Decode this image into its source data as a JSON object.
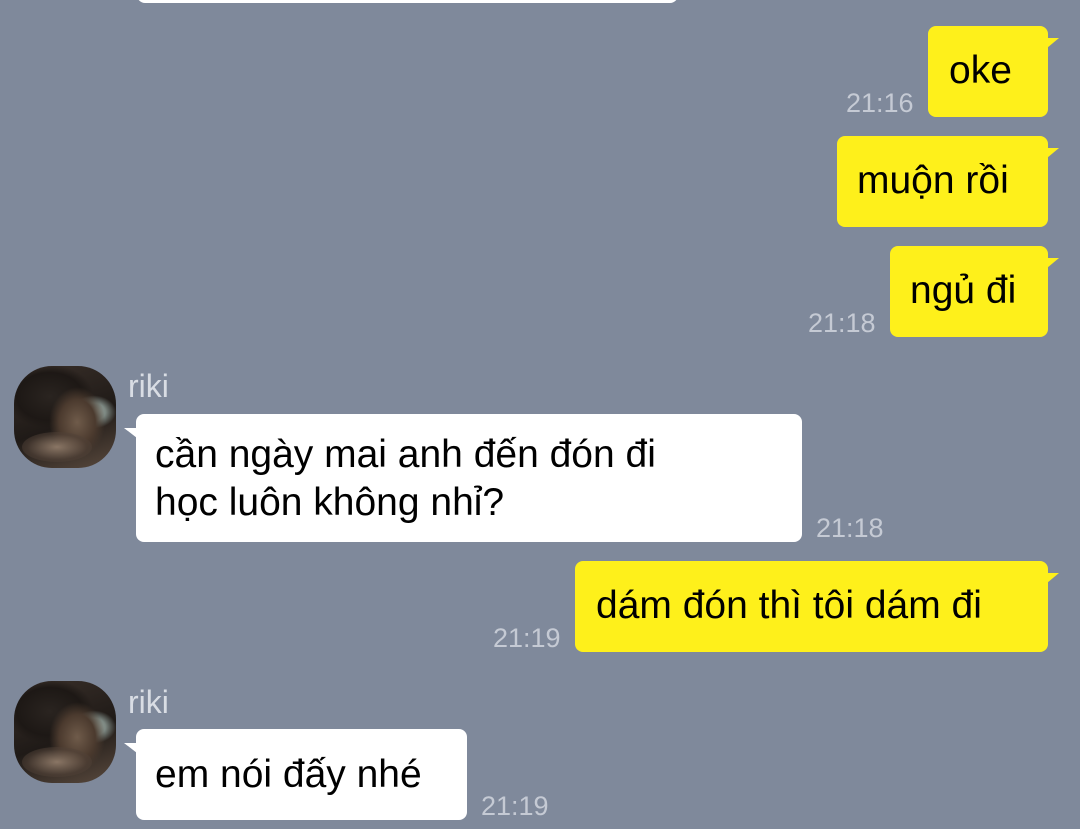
{
  "chat": {
    "messages": [
      {
        "id": "m1",
        "direction": "out",
        "text": "oke",
        "time": "21:16"
      },
      {
        "id": "m2",
        "direction": "out",
        "text": "muộn rồi",
        "time": ""
      },
      {
        "id": "m3",
        "direction": "out",
        "text": "ngủ đi",
        "time": "21:18"
      },
      {
        "id": "m4",
        "direction": "in",
        "sender": "riki",
        "lines": [
          "cần ngày mai anh đến đón đi",
          "học luôn không nhỉ?"
        ],
        "time": "21:18"
      },
      {
        "id": "m5",
        "direction": "out",
        "text": "dám đón thì tôi dám đi",
        "time": "21:19"
      },
      {
        "id": "m6",
        "direction": "in",
        "sender": "riki",
        "text": "em nói đấy nhé",
        "time": "21:19"
      }
    ]
  },
  "colors": {
    "background": "#7f899b",
    "outgoing_bubble": "#fef01b",
    "incoming_bubble": "#ffffff",
    "timestamp": "#c5cad4",
    "sender_name": "#d9dde4"
  },
  "icons": {
    "avatar": "avatar-photo"
  }
}
